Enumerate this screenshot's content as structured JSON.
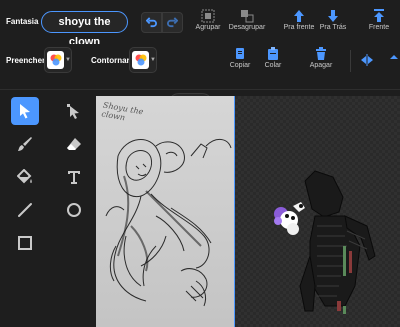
{
  "toolbar": {
    "costume_label": "Fantasia",
    "costume_name": "shoyu the clown",
    "group_label": "Agrupar",
    "ungroup_label": "Desagrupar",
    "forward_label": "Pra frente",
    "backward_label": "Pra Trás",
    "front_label": "Frente",
    "fill_label": "Preencher",
    "outline_label": "Contornar",
    "outline_width": "0",
    "copy_label": "Copiar",
    "paste_label": "Colar",
    "delete_label": "Apagar"
  },
  "canvas": {
    "sketch_text": "Shoyu the clown"
  },
  "colors": {
    "accent": "#4c97ff",
    "delete": "#e64c4c",
    "background": "#1e1e1e"
  },
  "tools": [
    "select",
    "reshape",
    "brush",
    "eraser",
    "fill",
    "text",
    "line",
    "circle",
    "rectangle"
  ]
}
